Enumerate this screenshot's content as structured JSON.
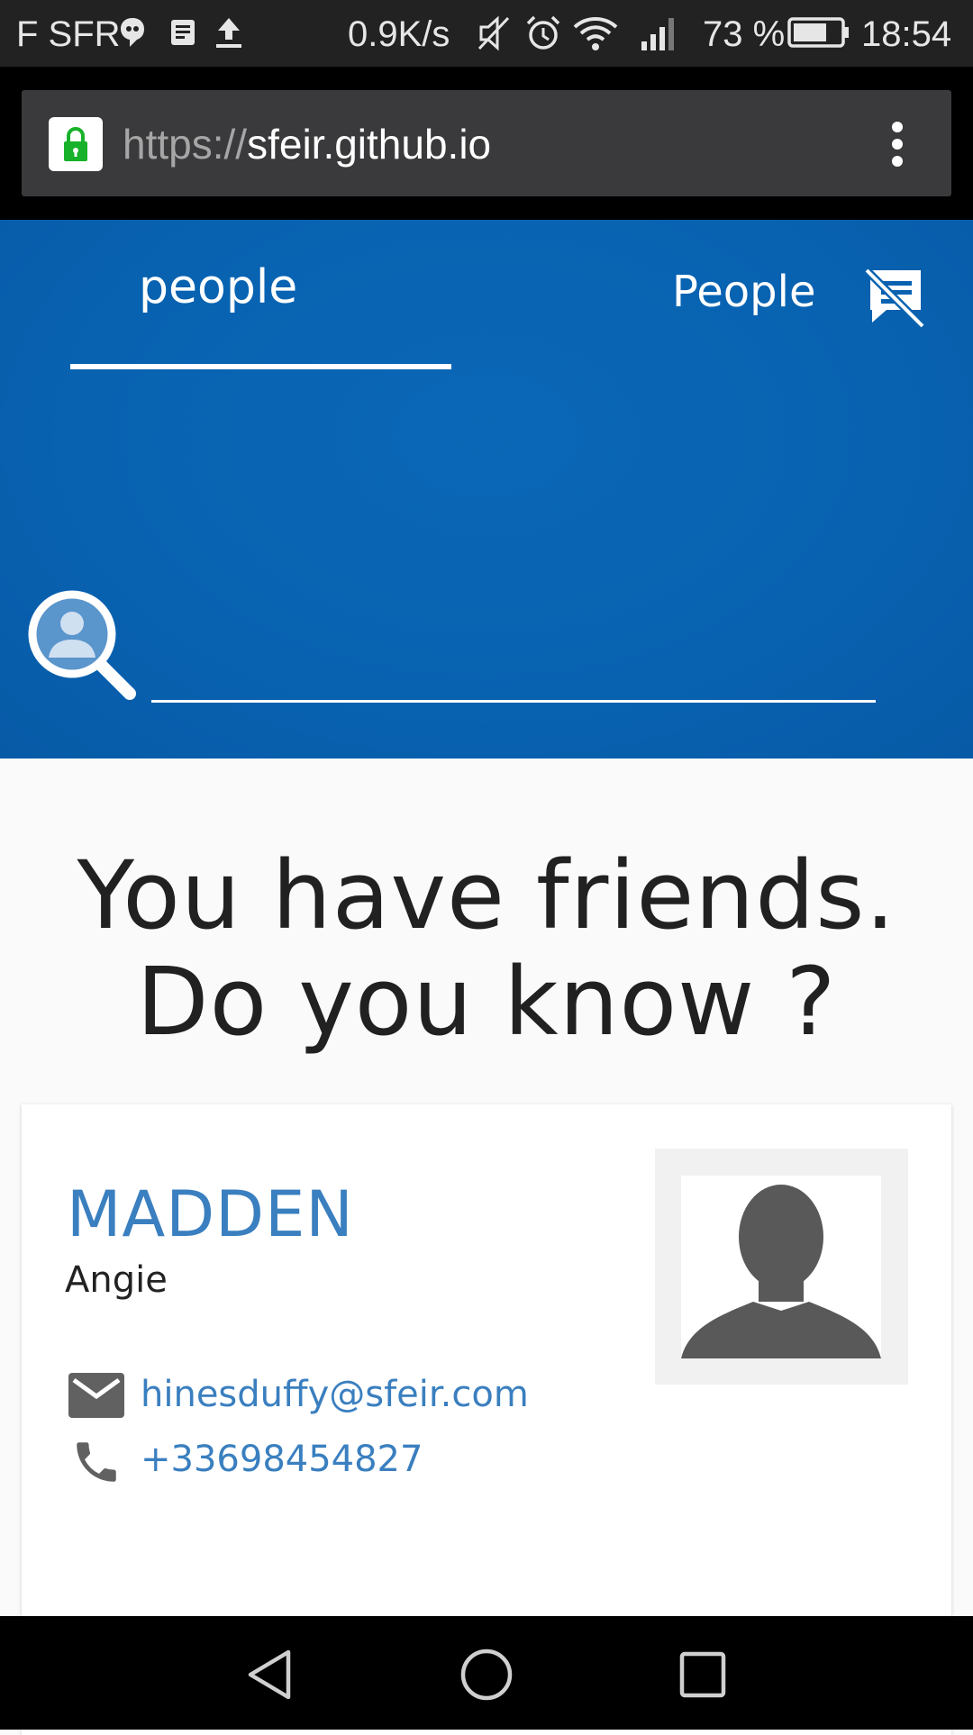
{
  "status_bar": {
    "carrier": "F SFR",
    "speed": "0.9K/s",
    "battery": "73 %",
    "time": "18:54",
    "icons": [
      "chat-bubble-icon",
      "notes-icon",
      "upload-icon",
      "mute-icon",
      "alarm-icon",
      "wifi-icon",
      "signal-icon",
      "battery-icon"
    ]
  },
  "browser": {
    "url_scheme": "https://",
    "url_host": "sfeir.github.io",
    "icons": [
      "lock-icon",
      "more-vert-icon"
    ]
  },
  "header": {
    "logo_text": "people",
    "nav_label": "People",
    "icons": [
      "speaker-notes-off-icon",
      "person-search-icon"
    ],
    "colors": {
      "primary": "#0862b0",
      "text": "#ffffff"
    }
  },
  "search": {
    "value": "",
    "placeholder": ""
  },
  "main": {
    "headline_line1": "You have friends.",
    "headline_line2": "Do you know ?"
  },
  "card": {
    "lastname": "MADDEN",
    "firstname": "Angie",
    "email": "hinesduffy@sfeir.com",
    "phone": "+33698454827",
    "icons": [
      "avatar-icon",
      "mail-icon",
      "phone-icon"
    ],
    "colors": {
      "link": "#3a7fbf",
      "icon": "#616161"
    }
  },
  "nav_bar": {
    "icons": [
      "back-icon",
      "home-icon",
      "recents-icon"
    ]
  }
}
